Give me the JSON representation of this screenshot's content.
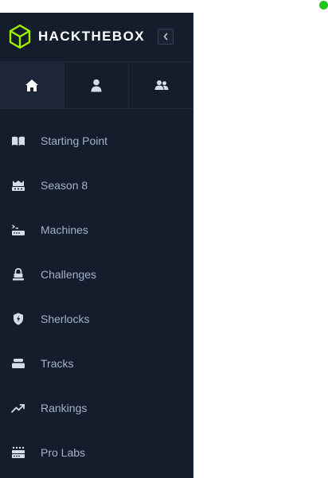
{
  "brand": {
    "name": "HACKTHEBOX",
    "accent_color": "#9fef00",
    "logo_icon": "hexagon-cube-icon"
  },
  "collapse_button": {
    "icon": "chevron-left-icon"
  },
  "tabs": [
    {
      "icon": "home-icon",
      "active": true
    },
    {
      "icon": "user-icon",
      "active": false
    },
    {
      "icon": "users-icon",
      "active": false
    }
  ],
  "nav": {
    "items": [
      {
        "label": "Starting Point",
        "icon": "book-open-icon"
      },
      {
        "label": "Season 8",
        "icon": "crown-icon"
      },
      {
        "label": "Machines",
        "icon": "server-terminal-icon"
      },
      {
        "label": "Challenges",
        "icon": "lock-icon"
      },
      {
        "label": "Sherlocks",
        "icon": "shield-bolt-icon"
      },
      {
        "label": "Tracks",
        "icon": "stack-icon"
      },
      {
        "label": "Rankings",
        "icon": "trending-up-icon"
      },
      {
        "label": "Pro Labs",
        "icon": "lab-panel-icon"
      }
    ]
  },
  "colors": {
    "sidebar_bg": "#141d2b",
    "nav_text": "#a4b1cd",
    "icon": "#d5dcea",
    "status_dot": "#22c51e"
  }
}
